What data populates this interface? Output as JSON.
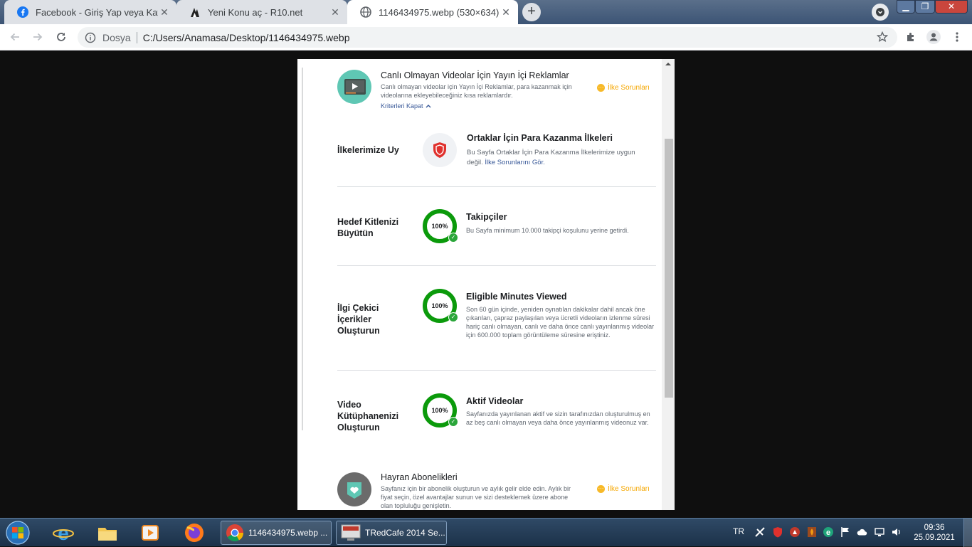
{
  "browser": {
    "tabs": [
      {
        "title": "Facebook - Giriş Yap veya Kaydol",
        "favicon": "facebook-icon",
        "close": "✕"
      },
      {
        "title": "Yeni Konu aç - R10.net",
        "favicon": "r10-icon",
        "close": "✕"
      },
      {
        "title": "1146434975.webp (530×634)",
        "favicon": "globe-icon",
        "close": "✕"
      }
    ],
    "new_tab": "+",
    "window_controls": {
      "minimize": "▁",
      "maximize": "❐",
      "close": "✕"
    },
    "address": {
      "scheme_label": "Dosya",
      "url": "C:/Users/Anamasa/Desktop/1146434975.webp"
    }
  },
  "content": {
    "top_section": {
      "title": "Canlı Olmayan Videolar İçin Yayın İçi Reklamlar",
      "description": "Canlı olmayan videolar için Yayın İçi Reklamlar, para kazanmak için videolarına ekleyebileceğiniz kısa reklamlardır.",
      "criteria_link": "Kriterleri Kapat",
      "status": "İlke Sorunları",
      "status_dot": "···"
    },
    "criteria": [
      {
        "label": "İlkelerimize Uy",
        "title": "Ortaklar İçin Para Kazanma İlkeleri",
        "description": "Bu Sayfa Ortaklar İçin Para Kazanma İlkelerimize uygun değil.",
        "link": "İlke Sorunlarını Gör."
      },
      {
        "label": "Hedef Kitlenizi Büyütün",
        "progress": "100%",
        "progress_value": 100,
        "title": "Takipçiler",
        "description": "Bu Sayfa minimum 10.000 takipçi koşulunu yerine getirdi."
      },
      {
        "label": "İlgi Çekici İçerikler Oluşturun",
        "progress": "100%",
        "progress_value": 100,
        "title": "Eligible Minutes Viewed",
        "description": "Son 60 gün içinde, yeniden oynatılan dakikalar dahil ancak öne çıkarılan, çapraz paylaşılan veya ücretli videoların izlenme süresi hariç canlı olmayan, canlı ve daha önce canlı yayınlanmış videolar için 600.000 toplam görüntüleme süresine eriştiniz."
      },
      {
        "label": "Video Kütüphanenizi Oluşturun",
        "progress": "100%",
        "progress_value": 100,
        "title": "Aktif Videolar",
        "description": "Sayfanızda yayınlanan aktif ve sizin tarafınızdan oluşturulmuş en az beş canlı olmayan veya daha önce yayınlanmış videonuz var."
      }
    ],
    "bottom_section": {
      "title": "Hayran Abonelikleri",
      "description": "Sayfanız için bir abonelik oluşturun ve aylık gelir elde edin. Aylık bir fiyat seçin, özel avantajlar sunun ve sizi desteklemek üzere abone olan topluluğu genişletin.",
      "status": "İlke Sorunları",
      "status_dot": "···"
    },
    "check_mark": "✓"
  },
  "taskbar": {
    "apps": [
      {
        "label": "1146434975.webp ...",
        "icon": "chrome-icon"
      },
      {
        "label": "TRedCafe 2014 Se...",
        "icon": "tredcafe-icon"
      }
    ],
    "language": "TR",
    "time": "09:36",
    "date": "25.09.2021"
  },
  "colors": {
    "ring_green": "#0b9a0b",
    "warning_orange": "#f5a700",
    "link_blue": "#385898",
    "shield_red": "#e0312d",
    "teal_icon": "#5fc7b4"
  }
}
